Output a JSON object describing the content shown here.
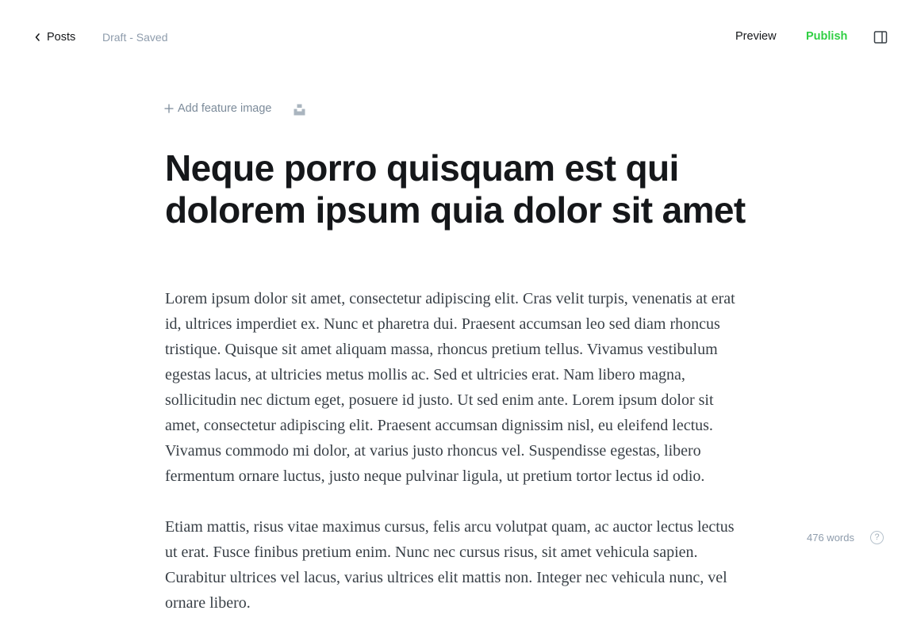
{
  "header": {
    "back_label": "Posts",
    "status": "Draft - Saved",
    "preview_label": "Preview",
    "publish_label": "Publish",
    "icons": {
      "back": "chevron-left-icon",
      "sidebar": "sidebar-toggle-icon"
    }
  },
  "editor": {
    "feature_image_label": "Add feature image",
    "title": "Neque porro quisquam est qui dolorem ipsum quia dolor sit amet",
    "paragraphs": [
      "Lorem ipsum dolor sit amet, consectetur adipiscing elit. Cras velit turpis, venenatis at erat id, ultrices imperdiet ex. Nunc et pharetra dui. Praesent accumsan leo sed diam rhoncus tristique. Quisque sit amet aliquam massa, rhoncus pretium tellus. Vivamus vestibulum egestas lacus, at ultricies metus mollis ac. Sed et ultricies erat. Nam libero magna, sollicitudin nec dictum eget, posuere id justo. Ut sed enim ante. Lorem ipsum dolor sit amet, consectetur adipiscing elit. Praesent accumsan dignissim nisl, eu eleifend lectus. Vivamus commodo mi dolor, at varius justo rhoncus vel. Suspendisse egestas, libero fermentum ornare luctus, justo neque pulvinar ligula, ut pretium tortor lectus id odio.",
      "Etiam mattis, risus vitae maximus cursus, felis arcu volutpat quam, ac auctor lectus lectus ut erat. Fusce finibus pretium enim. Nunc nec cursus risus, sit amet vehicula sapien. Curabitur ultrices vel lacus, varius ultrices elit mattis non. Integer nec vehicula nunc, vel ornare libero."
    ]
  },
  "footer": {
    "word_count": "476 words",
    "help_glyph": "?"
  },
  "colors": {
    "publish": "#30cf43",
    "muted": "#8e9cac",
    "text": "#15171a",
    "body_text": "#394047"
  }
}
